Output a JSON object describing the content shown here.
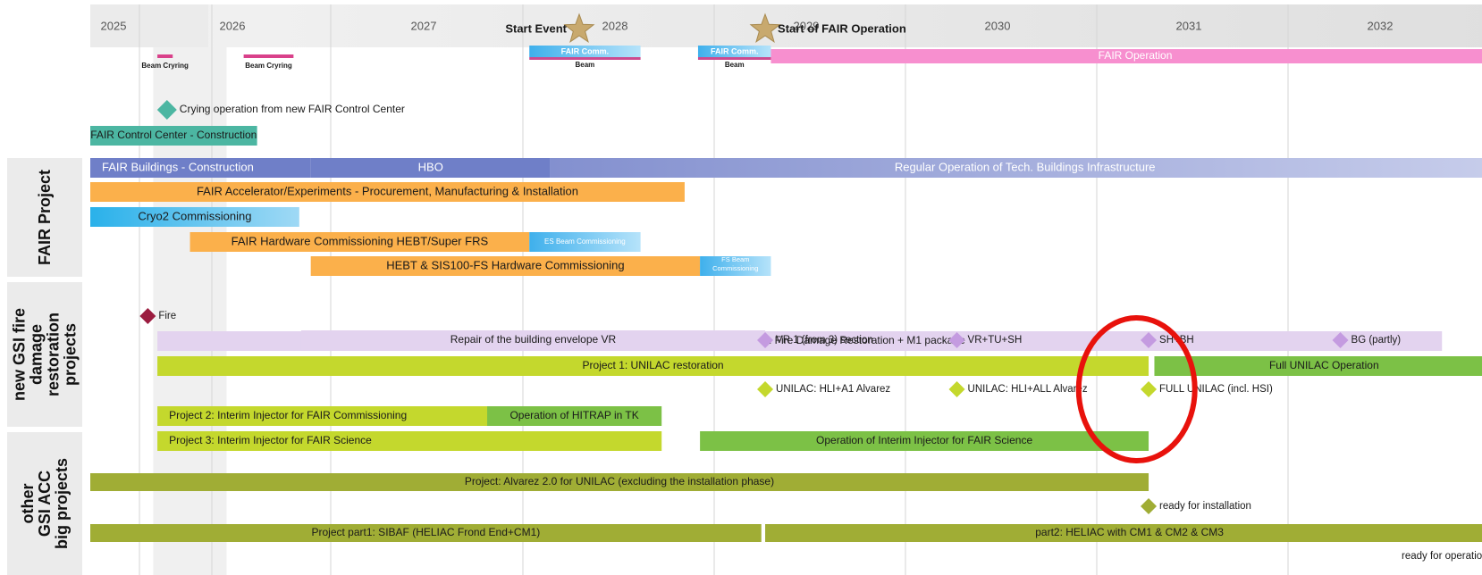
{
  "chart_data": {
    "type": "gantt",
    "x_axis": {
      "years": [
        "2025",
        "2026",
        "2027",
        "2028",
        "2029",
        "2030",
        "2031",
        "2032"
      ],
      "range": [
        2024.9,
        2032.25
      ],
      "grid": true
    },
    "groups": [
      {
        "label": "FAIR Project",
        "rows": [
          6,
          11
        ]
      },
      {
        "label": "new GSI fire damage restoration projects",
        "rows": [
          12,
          18
        ]
      },
      {
        "label": "other GSI ACC big projects",
        "rows": [
          19,
          22
        ]
      }
    ],
    "milestones": [
      {
        "label": "Start Event",
        "x": 2027.45,
        "row": 1,
        "shape": "star",
        "color": "#c8a96e",
        "label_side": "left"
      },
      {
        "label": "Start of FAIR Operation",
        "x": 2028.42,
        "row": 1,
        "shape": "star",
        "color": "#c8a96e",
        "label_side": "right"
      },
      {
        "label": "Crying operation from new FAIR Control Center",
        "x": 2025.3,
        "row": 4,
        "shape": "diamond",
        "color": "#4cb6a2",
        "label_side": "right"
      },
      {
        "label": "Fire",
        "x": 2025.2,
        "row": 12,
        "shape": "diamond",
        "color": "#9b1c3f",
        "label_side": "right"
      },
      {
        "label": "VR 1 (from 3) section",
        "x": 2028.42,
        "row": 14,
        "shape": "diamond",
        "color": "#c49be0",
        "label_side": "right"
      },
      {
        "label": "VR+TU+SH",
        "x": 2029.42,
        "row": 14,
        "shape": "diamond",
        "color": "#c49be0",
        "label_side": "right"
      },
      {
        "label": "SH+BH",
        "x": 2030.42,
        "row": 14,
        "shape": "diamond",
        "color": "#c49be0",
        "label_side": "right"
      },
      {
        "label": "BG (partly)",
        "x": 2031.42,
        "row": 14,
        "shape": "diamond",
        "color": "#c49be0",
        "label_side": "right"
      },
      {
        "label": "UNILAC: HLI+A1 Alvarez",
        "x": 2028.42,
        "row": 16,
        "shape": "diamond",
        "color": "#c4d82d",
        "label_side": "right"
      },
      {
        "label": "UNILAC: HLI+ALL Alvarez",
        "x": 2029.42,
        "row": 16,
        "shape": "diamond",
        "color": "#c4d82d",
        "label_side": "right"
      },
      {
        "label": "FULL UNILAC (incl. HSI)",
        "x": 2030.42,
        "row": 16,
        "shape": "diamond",
        "color": "#c4d82d",
        "label_side": "right"
      },
      {
        "label": "ready for installation",
        "x": 2030.42,
        "row": 20,
        "shape": "diamond",
        "color": "#a0ad35",
        "label_side": "right"
      },
      {
        "label": "ready for operation",
        "x": 2032.25,
        "row": 22,
        "shape": "diamond",
        "color": "#a0ad35",
        "label_side": "left"
      }
    ],
    "tasks": [
      {
        "label": "Beam Cryring",
        "start": 2025.25,
        "end": 2025.33,
        "row": 2,
        "style": "thin",
        "color": "#d9418a",
        "label_below": true
      },
      {
        "label": "Beam Cryring",
        "start": 2025.7,
        "end": 2025.96,
        "row": 2,
        "style": "thin",
        "color": "#d9418a",
        "label_below": true
      },
      {
        "label": "FAIR Comm.",
        "start": 2027.19,
        "end": 2027.77,
        "row": 2,
        "style": "comm",
        "color": "#3fb0ec",
        "color2": "#b6e3fa",
        "line_color": "#cc4a8f",
        "sublabel": "Beam"
      },
      {
        "label": "FAIR Comm.",
        "start": 2028.07,
        "end": 2028.45,
        "row": 2,
        "style": "comm",
        "color": "#3fb0ec",
        "color2": "#b6e3fa",
        "line_color": "#cc4a8f",
        "sublabel": "Beam"
      },
      {
        "label": "FAIR Operation",
        "start": 2028.45,
        "end": 2032.25,
        "row": 2,
        "color": "#f78fcf",
        "text_color": "#ffffff"
      },
      {
        "label": "FAIR Control Center - Construction",
        "start": 2024.9,
        "end": 2025.77,
        "row": 5,
        "color": "#4cb6a2",
        "text_color": "#1a1a1a"
      },
      {
        "label": "FAIR Buildings - Construction",
        "start": 2024.9,
        "end": 2026.05,
        "row": 6,
        "color": "#6f7fc8",
        "text_color": "#ffffff",
        "label_align": "start"
      },
      {
        "label": "HBO",
        "start": 2026.05,
        "end": 2027.3,
        "row": 6,
        "color": "#6f7fc8",
        "text_color": "#ffffff"
      },
      {
        "label": "Regular Operation of Tech. Buildings Infrastructure",
        "start": 2027.3,
        "end": 2032.25,
        "row": 6,
        "color": "#8390cf",
        "color2": "#c7cdeb",
        "text_color": "#ffffff"
      },
      {
        "label": "FAIR Accelerator/Experiments - Procurement, Manufacturing & Installation",
        "start": 2024.9,
        "end": 2028.0,
        "row": 7,
        "color": "#fbb04b",
        "text_color": "#1a1a1a"
      },
      {
        "label": "Cryo2 Commissioning",
        "start": 2024.9,
        "end": 2025.99,
        "row": 8,
        "color": "#2ab1ea",
        "color2": "#9fd9f5",
        "text_color": "#1a1a1a"
      },
      {
        "label": "FAIR Hardware Commissioning HEBT/Super FRS",
        "start": 2025.42,
        "end": 2027.19,
        "row": 9,
        "color": "#fbb04b",
        "text_color": "#1a1a1a"
      },
      {
        "label": "ES Beam Commissioning",
        "start": 2027.19,
        "end": 2027.77,
        "row": 9,
        "color": "#3fb0ec",
        "color2": "#b6e3fa",
        "text_color": "#ffffff",
        "small": true
      },
      {
        "label": "HEBT & SIS100-FS Hardware Commissioning",
        "start": 2026.05,
        "end": 2028.08,
        "row": 10,
        "color": "#fbb04b",
        "text_color": "#1a1a1a"
      },
      {
        "label": "FS Beam Commissioning",
        "start": 2028.08,
        "end": 2028.45,
        "row": 10,
        "color": "#3fb0ec",
        "color2": "#b6e3fa",
        "text_color": "#ffffff",
        "small": true,
        "wrap": [
          "FS Beam",
          "Commissioning"
        ]
      },
      {
        "label": "GSI Buildings Facility Works: Fire Damage Restoration + M1 package",
        "start": 2025.25,
        "end": 2031.95,
        "row": 13,
        "color": "#e3d3ef",
        "text_color": "#1a1a1a"
      },
      {
        "label": "Repair of the building envelope VR",
        "start": 2026.0,
        "end": 2028.42,
        "row": 14,
        "color": "#e3d3ef",
        "text_color": "#1a1a1a"
      },
      {
        "label": "Project 1: UNILAC restoration",
        "start": 2025.25,
        "end": 2030.42,
        "row": 15,
        "color": "#c4d82d",
        "text_color": "#1a1a1a"
      },
      {
        "label": "Full UNILAC Operation",
        "start": 2030.45,
        "end": 2032.22,
        "row": 15,
        "color": "#7cc146",
        "text_color": "#1a1a1a"
      },
      {
        "label": "Project 2: Interim Injector for FAIR Commissioning",
        "start": 2025.25,
        "end": 2026.97,
        "row": 17,
        "color": "#c4d82d",
        "text_color": "#1a1a1a",
        "label_align": "start"
      },
      {
        "label": "Operation of HITRAP in TK",
        "start": 2026.97,
        "end": 2027.88,
        "row": 17,
        "color": "#7cc146",
        "text_color": "#1a1a1a"
      },
      {
        "label": "Project 3: Interim Injector for FAIR Science",
        "start": 2025.25,
        "end": 2027.88,
        "row": 18,
        "color": "#c4d82d",
        "text_color": "#1a1a1a",
        "label_align": "start"
      },
      {
        "label": "Operation of Interim Injector for FAIR Science",
        "start": 2028.08,
        "end": 2030.42,
        "row": 18,
        "color": "#7cc146",
        "text_color": "#1a1a1a"
      },
      {
        "label": "Project: Alvarez 2.0 for UNILAC (excluding the installation phase)",
        "start": 2024.9,
        "end": 2030.42,
        "row": 19,
        "color": "#a0ad35",
        "text_color": "#1a1a1a"
      },
      {
        "label": "Project part1: SIBAF (HELIAC Frond End+CM1)",
        "start": 2024.9,
        "end": 2028.4,
        "row": 21,
        "color": "#a0ad35",
        "text_color": "#1a1a1a"
      },
      {
        "label": "part2: HELIAC with CM1 & CM2 & CM3",
        "start": 2028.42,
        "end": 2032.22,
        "row": 21,
        "color": "#a0ad35",
        "text_color": "#1a1a1a"
      }
    ],
    "annotations": [
      {
        "type": "ellipse",
        "x": 2030.33,
        "row": 16,
        "color": "#e8120c"
      }
    ],
    "colors": {
      "header": "#ebebeb",
      "shaded_band": "#f0f0f0",
      "group_label_box": "#ebebeb",
      "grid": "#d6d6d6"
    }
  }
}
